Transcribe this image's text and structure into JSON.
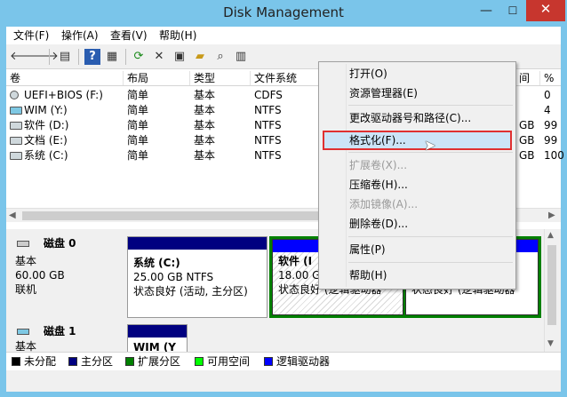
{
  "window": {
    "title": "Disk Management",
    "minimize": "—",
    "maximize": "☐",
    "close": "✕"
  },
  "menu": [
    "文件(F)",
    "操作(A)",
    "查看(V)",
    "帮助(H)"
  ],
  "toolbar_icons": [
    "back-arrow-icon",
    "forward-arrow-icon",
    "console-tree-icon",
    "help-icon",
    "properties-list-icon",
    "refresh-icon",
    "delete-icon",
    "properties-icon",
    "open-folder-icon",
    "search-icon",
    "rescan-icon"
  ],
  "columns": [
    "卷",
    "布局",
    "类型",
    "文件系统",
    "",
    "间",
    "%"
  ],
  "volumes": [
    {
      "name": "UEFI+BIOS (F:)",
      "layout": "简单",
      "type": "基本",
      "fs": "CDFS",
      "free": "",
      "pct": "0"
    },
    {
      "name": "WIM (Y:)",
      "layout": "简单",
      "type": "基本",
      "fs": "NTFS",
      "free": "",
      "pct": "4"
    },
    {
      "name": "软件 (D:)",
      "layout": "简单",
      "type": "基本",
      "fs": "NTFS",
      "free": "GB",
      "pct": "99"
    },
    {
      "name": "文档 (E:)",
      "layout": "简单",
      "type": "基本",
      "fs": "NTFS",
      "free": "GB",
      "pct": "99"
    },
    {
      "name": "系统 (C:)",
      "layout": "简单",
      "type": "基本",
      "fs": "NTFS",
      "free": "GB",
      "pct": "100"
    }
  ],
  "disk0": {
    "name": "磁盘 0",
    "type": "基本",
    "size": "60.00 GB",
    "status": "联机",
    "partitions": [
      {
        "title": "系统  (C:)",
        "size": "25.00 GB NTFS",
        "status": "状态良好 (活动, 主分区)"
      },
      {
        "title": "软件  (I",
        "size": "18.00 G",
        "status": "状态良好 (逻辑驱动器"
      },
      {
        "title": "",
        "size": "",
        "status": "状态良好 (逻辑驱动器"
      }
    ]
  },
  "disk1": {
    "name": "磁盘 1",
    "type": "基本",
    "partition_title": "WIM  (Y"
  },
  "legend": [
    {
      "label": "未分配",
      "color": "#000000"
    },
    {
      "label": "主分区",
      "color": "#000080"
    },
    {
      "label": "扩展分区",
      "color": "#008000"
    },
    {
      "label": "可用空间",
      "color": "#00ff00"
    },
    {
      "label": "逻辑驱动器",
      "color": "#0000ff"
    }
  ],
  "context_menu": {
    "open": "打开(O)",
    "explorer": "资源管理器(E)",
    "change_letter": "更改驱动器号和路径(C)...",
    "format": "格式化(F)...",
    "extend": "扩展卷(X)...",
    "shrink": "压缩卷(H)...",
    "mirror": "添加镜像(A)...",
    "delete": "删除卷(D)...",
    "properties": "属性(P)",
    "help": "帮助(H)"
  },
  "colors": {
    "titlebar": "#7ac5ea",
    "close": "#c7362e",
    "highlight": "#cce4f7",
    "highlight_border": "#e03030"
  }
}
